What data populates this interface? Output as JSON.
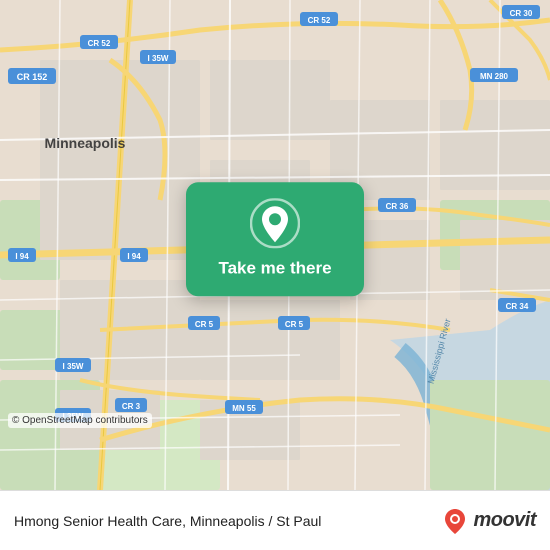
{
  "map": {
    "attribution": "© OpenStreetMap contributors",
    "background_color": "#e8ddd0"
  },
  "card": {
    "button_label": "Take me there",
    "pin_color": "#ffffff"
  },
  "bottom_bar": {
    "destination": "Hmong Senior Health Care, Minneapolis / St Paul",
    "logo_text": "moovit"
  }
}
